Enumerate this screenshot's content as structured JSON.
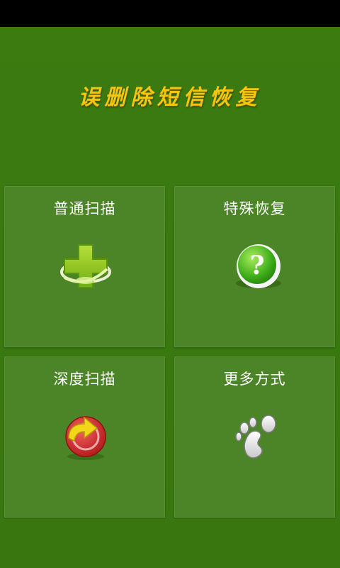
{
  "app": {
    "title": "误删除短信恢复"
  },
  "menu": {
    "items": [
      {
        "label": "普通扫描",
        "icon": "green-plus-icon"
      },
      {
        "label": "特殊恢复",
        "icon": "question-icon"
      },
      {
        "label": "深度扫描",
        "icon": "refresh-arrow-icon"
      },
      {
        "label": "更多方式",
        "icon": "footprint-icon"
      }
    ]
  },
  "colors": {
    "background": "#3b7b10",
    "tile": "#4b8527",
    "title": "#f6c60d",
    "statusbar": "#000000"
  }
}
